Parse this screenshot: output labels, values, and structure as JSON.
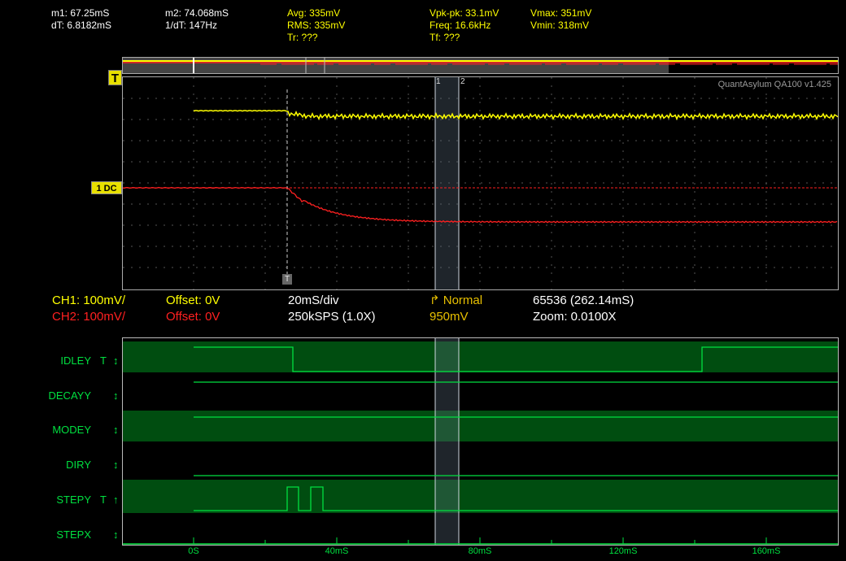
{
  "measurements": {
    "m1": "m1: 67.25mS",
    "dT": "dT: 6.8182mS",
    "m2": "m2: 74.068mS",
    "inv_dT": "1/dT: 147Hz",
    "avg": "Avg: 335mV",
    "rms": "RMS: 335mV",
    "tr": "Tr: ???",
    "vpkpk": "Vpk-pk: 33.1mV",
    "freq": "Freq: 16.6kHz",
    "tf": "Tf: ???",
    "vmax": "Vmax: 351mV",
    "vmin": "Vmin: 318mV"
  },
  "trigger_marker": "T",
  "channel_tag": "1 DC",
  "brand": "QuantAsylum QA100 v1.425",
  "cursors": {
    "c1": "1",
    "c2": "2"
  },
  "trigger_tag": "T",
  "settings": {
    "ch1": "CH1: 100mV/",
    "ch1_offset": "Offset: 0V",
    "ch2": "CH2: 100mV/",
    "ch2_offset": "Offset: 0V",
    "timebase": "20mS/div",
    "samplerate": "250kSPS (1.0X)",
    "trigger_mode_icon": "rising-edge-icon",
    "trigger_mode": "Normal",
    "trigger_level": "950mV",
    "record": "65536 (262.14mS)",
    "zoom": "Zoom: 0.0100X"
  },
  "colors": {
    "ch1": "#ffff00",
    "ch2": "#ff2020",
    "digital": "#00e040",
    "digital_band": "#004d10"
  },
  "digital_channels": [
    {
      "label": "IDLEY",
      "trigger": "T",
      "arrow": "↕"
    },
    {
      "label": "DECAYY",
      "trigger": "",
      "arrow": "↕"
    },
    {
      "label": "MODEY",
      "trigger": "",
      "arrow": "↕"
    },
    {
      "label": "DIRY",
      "trigger": "",
      "arrow": "↕"
    },
    {
      "label": "STEPY",
      "trigger": "T",
      "arrow": "↑"
    },
    {
      "label": "STEPX",
      "trigger": "",
      "arrow": "↕"
    }
  ],
  "time_axis": [
    "0S",
    "40mS",
    "80mS",
    "120mS",
    "160mS"
  ]
}
